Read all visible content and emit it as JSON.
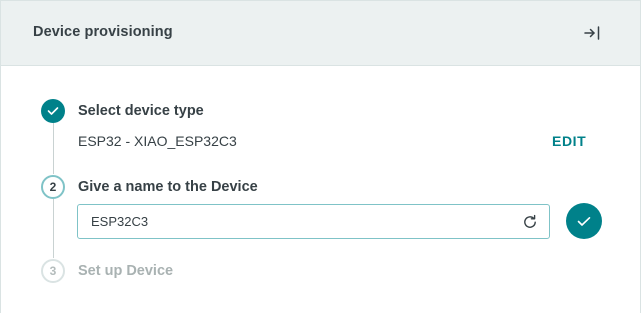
{
  "header": {
    "title": "Device provisioning",
    "close_icon": "exit-to-right-icon"
  },
  "steps": [
    {
      "number": "1",
      "title": "Select device type",
      "state": "completed",
      "value": "ESP32 - XIAO_ESP32C3",
      "action_label": "EDIT",
      "icon": "check-icon"
    },
    {
      "number": "2",
      "title": "Give a name to the Device",
      "state": "active",
      "input_value": "ESP32C3",
      "input_icon": "refresh-icon",
      "confirm_icon": "check-icon"
    },
    {
      "number": "3",
      "title": "Set up Device",
      "state": "pending"
    }
  ],
  "colors": {
    "accent": "#00818a",
    "header_bg": "#ecf1f1",
    "text": "#374146",
    "muted": "#a9b2b2"
  }
}
